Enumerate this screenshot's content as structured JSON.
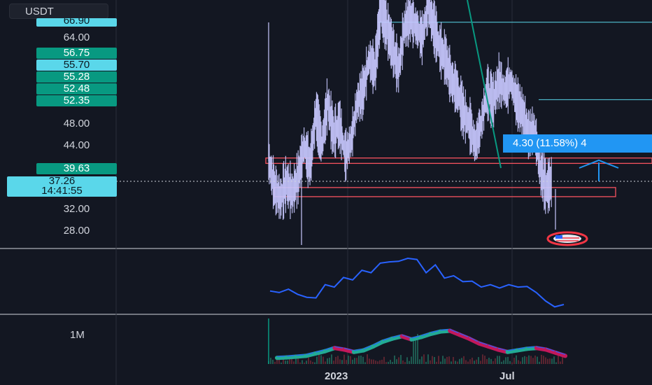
{
  "symbol": {
    "label": "USDT"
  },
  "price_scale": {
    "ticks": [
      "64.00",
      "48.00",
      "44.00",
      "32.00",
      "28.00"
    ],
    "cut_label": "66.90",
    "labels": [
      {
        "text": "56.75",
        "style": "teal"
      },
      {
        "text": "55.70",
        "style": "cyan"
      },
      {
        "text": "55.28",
        "style": "teal"
      },
      {
        "text": "52.48",
        "style": "teal"
      },
      {
        "text": "52.35",
        "style": "teal"
      },
      {
        "text": "39.63",
        "style": "teal"
      }
    ],
    "current_price": "37.26",
    "countdown": "14:41:55"
  },
  "measure": {
    "label": "4.30 (11.58%) 4"
  },
  "x_axis": {
    "labels": [
      "2023",
      "Jul"
    ]
  },
  "volume_scale": {
    "tick": "1M"
  },
  "colors": {
    "background": "#131722",
    "up": "#c8c8ff",
    "trendline": "#089981",
    "zone": "#f7525f",
    "level": "#5ad7ea",
    "indicator": "#2962ff",
    "measure": "#2196f3"
  },
  "chart_data": {
    "type": "line",
    "title": "",
    "xlabel": "",
    "ylabel": "",
    "ylim": [
      25,
      70
    ],
    "price_series": {
      "name": "",
      "points": [
        [
          0.0,
          41
        ],
        [
          0.02,
          36
        ],
        [
          0.04,
          34
        ],
        [
          0.06,
          37
        ],
        [
          0.08,
          35
        ],
        [
          0.1,
          38
        ],
        [
          0.12,
          44
        ],
        [
          0.14,
          40
        ],
        [
          0.16,
          50
        ],
        [
          0.18,
          44
        ],
        [
          0.2,
          52
        ],
        [
          0.22,
          46
        ],
        [
          0.24,
          48
        ],
        [
          0.26,
          42
        ],
        [
          0.28,
          45
        ],
        [
          0.3,
          52
        ],
        [
          0.32,
          54
        ],
        [
          0.34,
          60
        ],
        [
          0.36,
          58
        ],
        [
          0.38,
          70
        ],
        [
          0.4,
          66
        ],
        [
          0.42,
          62
        ],
        [
          0.44,
          58
        ],
        [
          0.46,
          66
        ],
        [
          0.48,
          68
        ],
        [
          0.5,
          66
        ],
        [
          0.52,
          64
        ],
        [
          0.54,
          70
        ],
        [
          0.56,
          66
        ],
        [
          0.58,
          62
        ],
        [
          0.6,
          60
        ],
        [
          0.62,
          56
        ],
        [
          0.64,
          54
        ],
        [
          0.66,
          50
        ],
        [
          0.68,
          48
        ],
        [
          0.7,
          44
        ],
        [
          0.72,
          48
        ],
        [
          0.74,
          54
        ],
        [
          0.76,
          52
        ],
        [
          0.78,
          56
        ],
        [
          0.8,
          54
        ],
        [
          0.82,
          56
        ],
        [
          0.84,
          52
        ],
        [
          0.86,
          50
        ],
        [
          0.88,
          46
        ],
        [
          0.9,
          47
        ],
        [
          0.92,
          39.63
        ],
        [
          0.94,
          36
        ],
        [
          0.96,
          37.26
        ]
      ]
    },
    "levels": [
      {
        "label": "66.90",
        "value": 66.9
      },
      {
        "label": "52.48",
        "value": 52.48
      }
    ],
    "zones": [
      [
        40.6,
        41.6
      ],
      [
        34.4,
        36.1
      ]
    ],
    "indicator_series": {
      "name": "",
      "values": [
        0.55,
        0.58,
        0.57,
        0.56,
        0.48,
        0.52,
        0.62,
        0.64,
        0.7,
        0.72,
        0.78,
        0.8,
        0.86,
        0.92,
        0.88,
        0.96,
        0.9,
        0.8,
        0.84,
        0.74,
        0.72,
        0.7,
        0.66,
        0.64,
        0.62,
        0.63,
        0.62,
        0.64,
        0.6,
        0.58,
        0.44,
        0.42,
        0.4
      ]
    },
    "volume_oscillator": {
      "name": "",
      "values": [
        0.05,
        0.06,
        0.08,
        0.1,
        0.16,
        0.22,
        0.3,
        0.26,
        0.2,
        0.24,
        0.34,
        0.46,
        0.54,
        0.6,
        0.52,
        0.58,
        0.66,
        0.72,
        0.74,
        0.64,
        0.54,
        0.42,
        0.34,
        0.26,
        0.2,
        0.24,
        0.28,
        0.3,
        0.26,
        0.18,
        0.1
      ]
    }
  }
}
